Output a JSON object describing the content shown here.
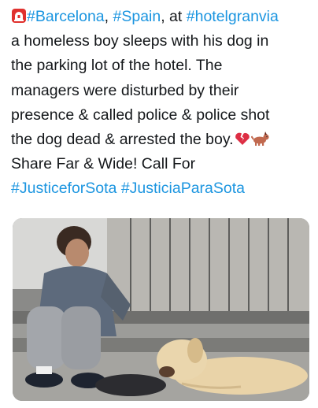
{
  "tweet": {
    "line1": {
      "emoji": "siren-emoji",
      "hashtag1": "#Barcelona",
      "sep1": ", ",
      "hashtag2": "#Spain",
      "sep2": ", at ",
      "hashtag3": "#hotelgranvia"
    },
    "line2": "a homeless boy sleeps with his dog in",
    "line3": "the parking lot of the hotel. The",
    "line4": "managers were disturbed by their",
    "line5": "presence & called police & police shot",
    "line6": {
      "text": "the dog dead & arrested the boy.",
      "emoji1": "broken-heart-emoji",
      "emoji2": "dog-emoji"
    },
    "line7": "Share Far & Wide! Call For",
    "line8": {
      "hashtag1": "#JusticeforSota",
      "hashtag2": "#JusticiaParaSota"
    }
  },
  "photo": {
    "subject": "boy-and-dog-photo"
  },
  "colors": {
    "link": "#1b95e0",
    "text": "#14171a",
    "background": "#ffffff"
  }
}
